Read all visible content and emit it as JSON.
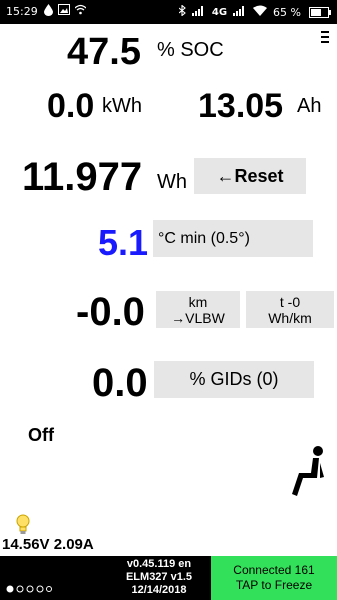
{
  "status_bar": {
    "time": "15:29",
    "network": "4G",
    "battery_percent": "65 %",
    "battery_level": 0.65
  },
  "soc": {
    "value": "47.5",
    "unit": "% SOC"
  },
  "energy": {
    "kwh_value": "0.0",
    "kwh_unit": "kWh",
    "ah_value": "13.05",
    "ah_unit": "Ah"
  },
  "wh": {
    "value": "11.977",
    "unit": "Wh",
    "reset_label": "←Reset"
  },
  "temperature": {
    "value": "5.1",
    "label": "°C min (0.5°)",
    "color": "#1a1aff"
  },
  "efficiency": {
    "value": "-0.0",
    "km_button_line1": "km",
    "km_button_line2": "→VLBW",
    "t_button_line1": "t -0",
    "t_button_line2": "Wh/km"
  },
  "gids": {
    "value": "0.0",
    "label": "% GIDs (0)"
  },
  "climate": {
    "state": "Off"
  },
  "voltage": {
    "text": "14.56V 2.09A"
  },
  "footer": {
    "version_line1": "v0.45.119 en",
    "version_line2": "ELM327 v1.5",
    "version_line3": "12/14/2018",
    "connected_line1": "Connected 161",
    "connected_line2": "TAP to Freeze",
    "connected_color": "#33e05a"
  }
}
